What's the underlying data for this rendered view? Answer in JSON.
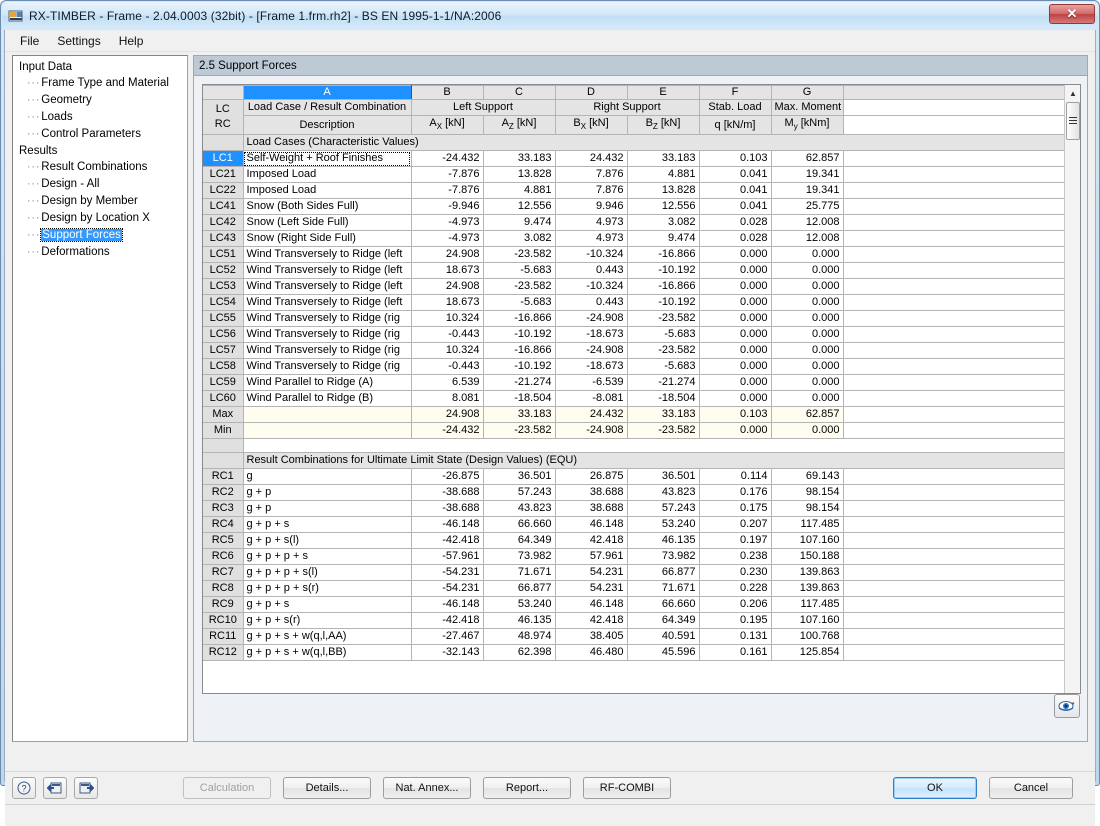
{
  "window": {
    "title": "RX-TIMBER - Frame - 2.04.0003 (32bit) - [Frame 1.frm.rh2] - BS EN 1995-1-1/NA:2006",
    "close_label": "✕"
  },
  "menu": {
    "items": [
      "File",
      "Settings",
      "Help"
    ]
  },
  "sidebar": {
    "groups": [
      {
        "label": "Input Data",
        "children": [
          "Frame Type and Material",
          "Geometry",
          "Loads",
          "Control Parameters"
        ]
      },
      {
        "label": "Results",
        "children": [
          "Result Combinations",
          "Design - All",
          "Design by Member",
          "Design by Location X",
          "Support Forces",
          "Deformations"
        ]
      }
    ],
    "selected": "Support Forces"
  },
  "panel": {
    "header": "2.5 Support Forces"
  },
  "grid": {
    "column_letters": [
      "",
      "A",
      "B",
      "C",
      "D",
      "E",
      "F",
      "G",
      ""
    ],
    "selected_column": "A",
    "rowhdr_line1": "LC",
    "rowhdr_line2": "RC",
    "header_groups": [
      {
        "title": "Load Case / Result Combination",
        "sub": "Description"
      },
      {
        "title": "Left Support",
        "sub1": "A",
        "sub1sub": "X",
        "sub1unit": " [kN]",
        "sub2": "A",
        "sub2sub": "Z",
        "sub2unit": " [kN]"
      },
      {
        "title": "Right Support",
        "sub1": "B",
        "sub1sub": "X",
        "sub1unit": " [kN]",
        "sub2": "B",
        "sub2sub": "Z",
        "sub2unit": " [kN]"
      },
      {
        "title": "Stab. Load",
        "sub": "q [kN/m]"
      },
      {
        "title": "Max. Moment",
        "sub_pre": "M",
        "sub_sub": "y",
        "sub_unit": " [kNm]"
      }
    ],
    "section1_label": "Load Cases (Characteristic Values)",
    "section2_label": "Result Combinations for Ultimate Limit State (Design Values) (EQU)",
    "rows_lc": [
      {
        "id": "LC1",
        "desc": "Self-Weight + Roof Finishes",
        "ax": "-24.432",
        "az": "33.183",
        "bx": "24.432",
        "bz": "33.183",
        "q": "0.103",
        "my": "62.857",
        "selected": true
      },
      {
        "id": "LC21",
        "desc": "Imposed Load",
        "ax": "-7.876",
        "az": "13.828",
        "bx": "7.876",
        "bz": "4.881",
        "q": "0.041",
        "my": "19.341"
      },
      {
        "id": "LC22",
        "desc": "Imposed Load",
        "ax": "-7.876",
        "az": "4.881",
        "bx": "7.876",
        "bz": "13.828",
        "q": "0.041",
        "my": "19.341"
      },
      {
        "id": "LC41",
        "desc": "Snow (Both Sides Full)",
        "ax": "-9.946",
        "az": "12.556",
        "bx": "9.946",
        "bz": "12.556",
        "q": "0.041",
        "my": "25.775"
      },
      {
        "id": "LC42",
        "desc": "Snow (Left Side Full)",
        "ax": "-4.973",
        "az": "9.474",
        "bx": "4.973",
        "bz": "3.082",
        "q": "0.028",
        "my": "12.008"
      },
      {
        "id": "LC43",
        "desc": "Snow (Right Side Full)",
        "ax": "-4.973",
        "az": "3.082",
        "bx": "4.973",
        "bz": "9.474",
        "q": "0.028",
        "my": "12.008"
      },
      {
        "id": "LC51",
        "desc": "Wind Transversely to Ridge (left",
        "ax": "24.908",
        "az": "-23.582",
        "bx": "-10.324",
        "bz": "-16.866",
        "q": "0.000",
        "my": "0.000"
      },
      {
        "id": "LC52",
        "desc": "Wind Transversely to Ridge (left",
        "ax": "18.673",
        "az": "-5.683",
        "bx": "0.443",
        "bz": "-10.192",
        "q": "0.000",
        "my": "0.000"
      },
      {
        "id": "LC53",
        "desc": "Wind Transversely to Ridge (left",
        "ax": "24.908",
        "az": "-23.582",
        "bx": "-10.324",
        "bz": "-16.866",
        "q": "0.000",
        "my": "0.000"
      },
      {
        "id": "LC54",
        "desc": "Wind Transversely to Ridge (left",
        "ax": "18.673",
        "az": "-5.683",
        "bx": "0.443",
        "bz": "-10.192",
        "q": "0.000",
        "my": "0.000"
      },
      {
        "id": "LC55",
        "desc": "Wind Transversely to Ridge (rig",
        "ax": "10.324",
        "az": "-16.866",
        "bx": "-24.908",
        "bz": "-23.582",
        "q": "0.000",
        "my": "0.000"
      },
      {
        "id": "LC56",
        "desc": "Wind Transversely to Ridge (rig",
        "ax": "-0.443",
        "az": "-10.192",
        "bx": "-18.673",
        "bz": "-5.683",
        "q": "0.000",
        "my": "0.000"
      },
      {
        "id": "LC57",
        "desc": "Wind Transversely to Ridge (rig",
        "ax": "10.324",
        "az": "-16.866",
        "bx": "-24.908",
        "bz": "-23.582",
        "q": "0.000",
        "my": "0.000"
      },
      {
        "id": "LC58",
        "desc": "Wind Transversely to Ridge (rig",
        "ax": "-0.443",
        "az": "-10.192",
        "bx": "-18.673",
        "bz": "-5.683",
        "q": "0.000",
        "my": "0.000"
      },
      {
        "id": "LC59",
        "desc": "Wind Parallel to Ridge (A)",
        "ax": "6.539",
        "az": "-21.274",
        "bx": "-6.539",
        "bz": "-21.274",
        "q": "0.000",
        "my": "0.000"
      },
      {
        "id": "LC60",
        "desc": "Wind Parallel to Ridge (B)",
        "ax": "8.081",
        "az": "-18.504",
        "bx": "-8.081",
        "bz": "-18.504",
        "q": "0.000",
        "my": "0.000"
      }
    ],
    "rows_minmax": [
      {
        "id": "Max",
        "desc": "",
        "ax": "24.908",
        "az": "33.183",
        "bx": "24.432",
        "bz": "33.183",
        "q": "0.103",
        "my": "62.857"
      },
      {
        "id": "Min",
        "desc": "",
        "ax": "-24.432",
        "az": "-23.582",
        "bx": "-24.908",
        "bz": "-23.582",
        "q": "0.000",
        "my": "0.000"
      }
    ],
    "rows_rc": [
      {
        "id": "RC1",
        "desc": "g",
        "ax": "-26.875",
        "az": "36.501",
        "bx": "26.875",
        "bz": "36.501",
        "q": "0.114",
        "my": "69.143"
      },
      {
        "id": "RC2",
        "desc": "g + p",
        "ax": "-38.688",
        "az": "57.243",
        "bx": "38.688",
        "bz": "43.823",
        "q": "0.176",
        "my": "98.154"
      },
      {
        "id": "RC3",
        "desc": "g + p",
        "ax": "-38.688",
        "az": "43.823",
        "bx": "38.688",
        "bz": "57.243",
        "q": "0.175",
        "my": "98.154"
      },
      {
        "id": "RC4",
        "desc": "g + p + s",
        "ax": "-46.148",
        "az": "66.660",
        "bx": "46.148",
        "bz": "53.240",
        "q": "0.207",
        "my": "117.485"
      },
      {
        "id": "RC5",
        "desc": "g + p + s(l)",
        "ax": "-42.418",
        "az": "64.349",
        "bx": "42.418",
        "bz": "46.135",
        "q": "0.197",
        "my": "107.160"
      },
      {
        "id": "RC6",
        "desc": "g + p + p + s",
        "ax": "-57.961",
        "az": "73.982",
        "bx": "57.961",
        "bz": "73.982",
        "q": "0.238",
        "my": "150.188"
      },
      {
        "id": "RC7",
        "desc": "g + p + p + s(l)",
        "ax": "-54.231",
        "az": "71.671",
        "bx": "54.231",
        "bz": "66.877",
        "q": "0.230",
        "my": "139.863"
      },
      {
        "id": "RC8",
        "desc": "g + p + p + s(r)",
        "ax": "-54.231",
        "az": "66.877",
        "bx": "54.231",
        "bz": "71.671",
        "q": "0.228",
        "my": "139.863"
      },
      {
        "id": "RC9",
        "desc": "g + p + s",
        "ax": "-46.148",
        "az": "53.240",
        "bx": "46.148",
        "bz": "66.660",
        "q": "0.206",
        "my": "117.485"
      },
      {
        "id": "RC10",
        "desc": "g + p + s(r)",
        "ax": "-42.418",
        "az": "46.135",
        "bx": "42.418",
        "bz": "64.349",
        "q": "0.195",
        "my": "107.160"
      },
      {
        "id": "RC11",
        "desc": "g + p + s + w(q,l,AA)",
        "ax": "-27.467",
        "az": "48.974",
        "bx": "38.405",
        "bz": "40.591",
        "q": "0.131",
        "my": "100.768"
      },
      {
        "id": "RC12",
        "desc": "g + p + s + w(q,l,BB)",
        "ax": "-32.143",
        "az": "62.398",
        "bx": "46.480",
        "bz": "45.596",
        "q": "0.161",
        "my": "125.854"
      }
    ]
  },
  "bottom": {
    "icon_buttons": [
      "help-icon",
      "prev-icon",
      "next-icon"
    ],
    "buttons": [
      {
        "label": "Calculation",
        "disabled": true
      },
      {
        "label": "Details...",
        "disabled": false
      },
      {
        "label": "Nat. Annex...",
        "disabled": false
      },
      {
        "label": "Report...",
        "disabled": false
      },
      {
        "label": "RF-COMBI",
        "disabled": false
      }
    ],
    "ok_label": "OK",
    "cancel_label": "Cancel"
  },
  "colors": {
    "accent": "#1e90ff",
    "titlebar": "#c2def4",
    "minmax_bg": "#fffdf0"
  }
}
